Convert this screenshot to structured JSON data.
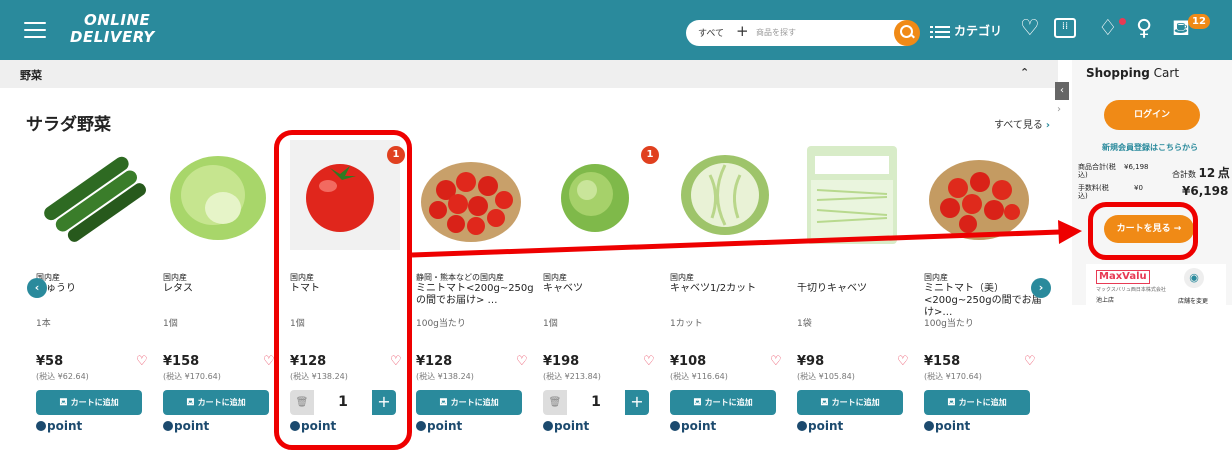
{
  "header": {
    "logo_line1": "ONLINE",
    "logo_line2": "DELIVERY",
    "search_category": "すべて",
    "search_plus": "+",
    "search_placeholder": "商品を探す",
    "category_label": "カテゴリ",
    "cart_count": "12",
    "colors": {
      "bar": "#2a8a9c",
      "accent": "#f08a16"
    }
  },
  "subbar": {
    "title": "野菜"
  },
  "section": {
    "title": "サラダ野菜",
    "see_all": "すべて見る"
  },
  "products": [
    {
      "origin": "国内産",
      "name": "きゅうり",
      "unit": "1本",
      "price": "¥58",
      "tax": "(税込 ¥62.64)",
      "add_label": "カートに追加",
      "in_cart": false
    },
    {
      "origin": "国内産",
      "name": "レタス",
      "unit": "1個",
      "price": "¥158",
      "tax": "(税込 ¥170.64)",
      "add_label": "カートに追加",
      "in_cart": false
    },
    {
      "origin": "国内産",
      "name": "トマト",
      "unit": "1個",
      "price": "¥128",
      "tax": "(税込 ¥138.24)",
      "qty": "1",
      "badge": "1",
      "in_cart": true
    },
    {
      "origin": "静岡・熊本などの国内産",
      "name": "ミニトマト<200g~250gの間でお届け> …",
      "unit": "100g当たり",
      "price": "¥128",
      "tax": "(税込 ¥138.24)",
      "add_label": "カートに追加",
      "in_cart": false
    },
    {
      "origin": "国内産",
      "name": "キャベツ",
      "unit": "1個",
      "price": "¥198",
      "tax": "(税込 ¥213.84)",
      "qty": "1",
      "badge": "1",
      "in_cart": true
    },
    {
      "origin": "国内産",
      "name": "キャベツ1/2カット",
      "unit": "1カット",
      "price": "¥108",
      "tax": "(税込 ¥116.64)",
      "add_label": "カートに追加",
      "in_cart": false
    },
    {
      "origin": "",
      "name": "千切りキャベツ",
      "unit": "1袋",
      "price": "¥98",
      "tax": "(税込 ¥105.84)",
      "add_label": "カートに追加",
      "in_cart": false
    },
    {
      "origin": "国内産",
      "name": "ミニトマト（美）<200g~250gの間でお届け>…",
      "unit": "100g当たり",
      "price": "¥158",
      "tax": "(税込 ¥170.64)",
      "add_label": "カートに追加",
      "in_cart": false
    }
  ],
  "point_label": "point",
  "cart": {
    "title_bold": "Shopping",
    "title_rest": " Cart",
    "login": "ログイン",
    "register": "新規会員登録はこちらから",
    "subtotal_label": "商品合計(税込)",
    "subtotal_value": "¥6,198",
    "fee_label": "手数料(税込)",
    "fee_value": "¥0",
    "count_label": "合計数",
    "count_value": "12",
    "count_unit": "点",
    "total": "¥6,198",
    "view_cart": "カートを見る →"
  },
  "store": {
    "brand": "MaxValu",
    "sub": "マックスバリュ西日本株式会社",
    "name": "池上店",
    "change": "店舗を変更"
  }
}
